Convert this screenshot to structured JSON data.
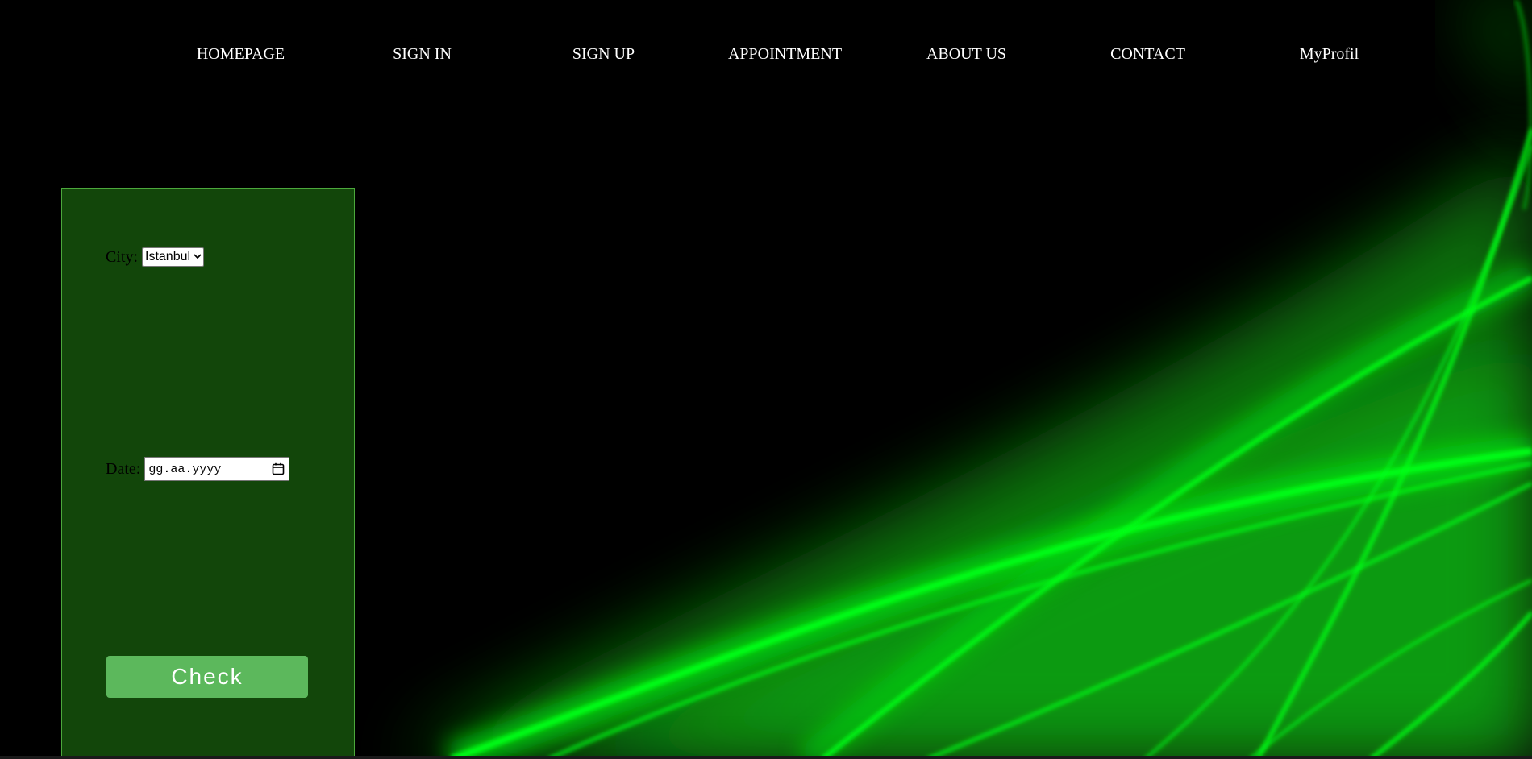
{
  "nav": {
    "items": [
      {
        "label": "HOMEPAGE"
      },
      {
        "label": "SIGN IN"
      },
      {
        "label": "SIGN UP"
      },
      {
        "label": "APPOINTMENT"
      },
      {
        "label": "ABOUT US"
      },
      {
        "label": "CONTACT"
      },
      {
        "label": "MyProfil"
      }
    ]
  },
  "form": {
    "city_label": "City:",
    "city_value": "Istanbul",
    "date_label": "Date:",
    "date_placeholder": "gg.aa.yyyy",
    "check_label": "Check"
  },
  "colors": {
    "background": "#000000",
    "panel": "#12460a",
    "panel_border": "#4ca83c",
    "button": "#5cb85c",
    "streak": "#00ff14"
  },
  "icons": {
    "calendar": "calendar-icon",
    "select_chevron": "chevron-down-icon"
  }
}
